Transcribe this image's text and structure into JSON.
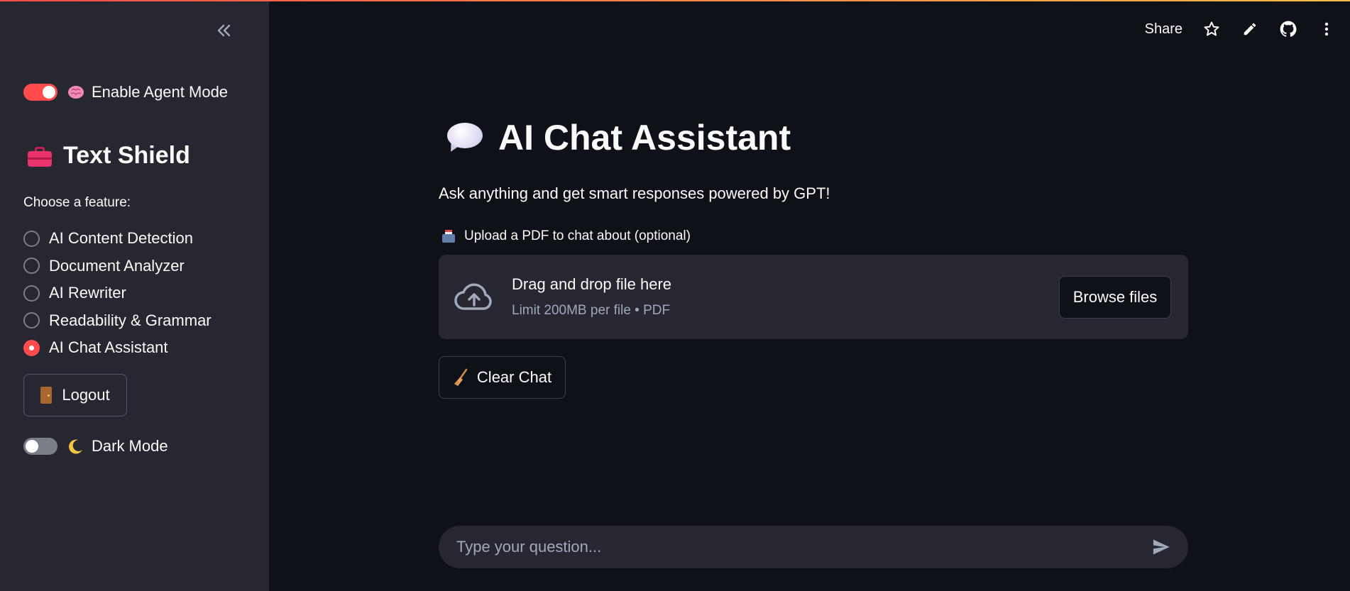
{
  "sidebar": {
    "agent_mode": {
      "label": "Enable Agent Mode",
      "icon": "brain-icon",
      "enabled": true
    },
    "title": "Text Shield",
    "title_icon": "toolbox-icon",
    "feature_prompt": "Choose a feature:",
    "features": [
      {
        "label": "AI Content Detection",
        "selected": false
      },
      {
        "label": "Document Analyzer",
        "selected": false
      },
      {
        "label": "AI Rewriter",
        "selected": false
      },
      {
        "label": "Readability & Grammar",
        "selected": false
      },
      {
        "label": "AI Chat Assistant",
        "selected": true
      }
    ],
    "logout_label": "Logout",
    "dark_mode": {
      "label": "Dark Mode",
      "icon": "crescent-moon-icon",
      "enabled": false
    }
  },
  "header": {
    "share_label": "Share",
    "icons": [
      "star-icon",
      "pencil-icon",
      "github-icon",
      "more-vertical-icon"
    ]
  },
  "main": {
    "title": "AI Chat Assistant",
    "title_icon": "speech-bubble-icon",
    "subtitle": "Ask anything and get smart responses powered by GPT!",
    "upload": {
      "label": "Upload a PDF to chat about (optional)",
      "dropzone_title": "Drag and drop file here",
      "dropzone_limit": "Limit 200MB per file • PDF",
      "browse_label": "Browse files"
    },
    "clear_label": "Clear Chat",
    "chat_input": {
      "placeholder": "Type your question...",
      "value": ""
    }
  },
  "colors": {
    "accent": "#ff4b4b",
    "sidebar_bg": "#262730",
    "main_bg": "#0e1117",
    "muted_text": "#a3a8b8"
  }
}
